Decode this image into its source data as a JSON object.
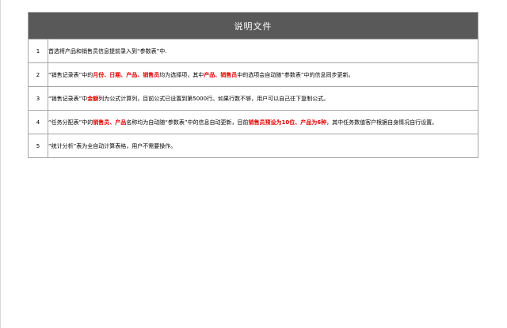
{
  "sheet": {
    "title": "说明文件",
    "rows": [
      {
        "num": "1",
        "segments": [
          {
            "text": "首选将产品和销售员信息提前录入到“参数表”中.",
            "hl": false
          }
        ]
      },
      {
        "num": "2",
        "segments": [
          {
            "text": "“销售记录表”中的",
            "hl": false
          },
          {
            "text": "月份、日期、产品、销售员",
            "hl": true
          },
          {
            "text": "均为选择项，其中",
            "hl": false
          },
          {
            "text": "产品、销售员",
            "hl": true
          },
          {
            "text": "中的选项会自动随“参数表”中的信息同步更新。",
            "hl": false
          }
        ]
      },
      {
        "num": "3",
        "segments": [
          {
            "text": "“销售记录表”中",
            "hl": false
          },
          {
            "text": "金额",
            "hl": true
          },
          {
            "text": "列为公式计算列，目前公式已设置到第5000行。如果行数不够，用户可以自己往下复制公式。",
            "hl": false
          }
        ]
      },
      {
        "num": "4",
        "segments": [
          {
            "text": "“任务分配表”中的",
            "hl": false
          },
          {
            "text": "销售员、产品",
            "hl": true
          },
          {
            "text": "名称均为自动随“参数表”中的信息自动更新，目前",
            "hl": false
          },
          {
            "text": "销售员预设为10位、产品为6种",
            "hl": true
          },
          {
            "text": "，其中任务数值客户根据自身情况自行设置。",
            "hl": false
          }
        ]
      },
      {
        "num": "5",
        "segments": [
          {
            "text": "“统计分析”表为全自动计算表格，用户不需要操作。",
            "hl": false
          }
        ]
      }
    ]
  }
}
